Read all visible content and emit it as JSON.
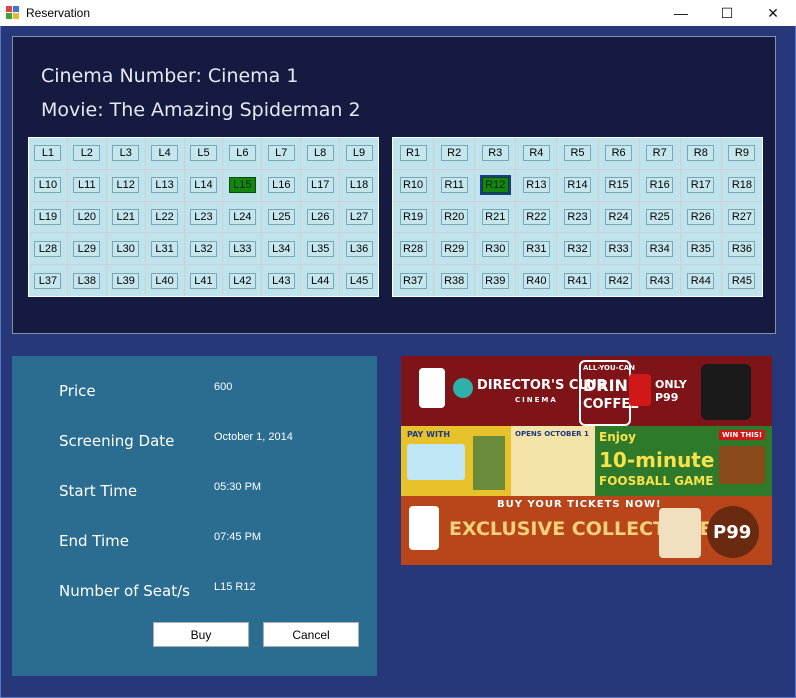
{
  "window": {
    "title": "Reservation",
    "minimize_glyph": "—",
    "maximize_glyph": "☐",
    "close_glyph": "✕"
  },
  "header": {
    "cinema_line": "Cinema Number: Cinema 1",
    "movie_line": "Movie: The Amazing Spiderman 2"
  },
  "seats": {
    "left": [
      "L1",
      "L2",
      "L3",
      "L4",
      "L5",
      "L6",
      "L7",
      "L8",
      "L9",
      "L10",
      "L11",
      "L12",
      "L13",
      "L14",
      "L15",
      "L16",
      "L17",
      "L18",
      "L19",
      "L20",
      "L21",
      "L22",
      "L23",
      "L24",
      "L25",
      "L26",
      "L27",
      "L28",
      "L29",
      "L30",
      "L31",
      "L32",
      "L33",
      "L34",
      "L35",
      "L36",
      "L37",
      "L38",
      "L39",
      "L40",
      "L41",
      "L42",
      "L43",
      "L44",
      "L45"
    ],
    "right": [
      "R1",
      "R2",
      "R3",
      "R4",
      "R5",
      "R6",
      "R7",
      "R8",
      "R9",
      "R10",
      "R11",
      "R12",
      "R13",
      "R14",
      "R15",
      "R16",
      "R17",
      "R18",
      "R19",
      "R20",
      "R21",
      "R22",
      "R23",
      "R24",
      "R25",
      "R26",
      "R27",
      "R28",
      "R29",
      "R30",
      "R31",
      "R32",
      "R33",
      "R34",
      "R35",
      "R36",
      "R37",
      "R38",
      "R39",
      "R40",
      "R41",
      "R42",
      "R43",
      "R44",
      "R45"
    ],
    "selected": [
      "L15",
      "R12"
    ],
    "focused": "R12",
    "selected_color": "#14860f"
  },
  "details": {
    "price_label": "Price",
    "price_value": "600",
    "date_label": "Screening Date",
    "date_value": "October 1, 2014",
    "start_label": "Start Time",
    "start_value": "05:30 PM",
    "end_label": "End Time",
    "end_value": "07:45 PM",
    "seats_label": "Number of Seat/s",
    "seats_value": "L15 R12",
    "buy_label": "Buy",
    "cancel_label": "Cancel"
  },
  "advert": {
    "banner1_brand": "DIRECTOR'S CLUB",
    "banner1_sub": "CINEMA",
    "banner1_offer1": "ALL-YOU-CAN",
    "banner1_offer2": "DRINK",
    "banner1_offer3": "COFFEE",
    "banner1_price": "ONLY P99",
    "banner2_pay": "PAY WITH",
    "banner2_opens": "OPENS OCTOBER 1",
    "banner2_enjoy": "Enjoy",
    "banner2_minute": "10-minute",
    "banner2_game": "FOOSBALL GAME",
    "banner2_win": "WIN THIS!",
    "banner3_tag": "BUY YOUR TICKETS NOW!",
    "banner3_title": "EXCLUSIVE COLLECTIBLE",
    "banner3_price": "P99"
  }
}
